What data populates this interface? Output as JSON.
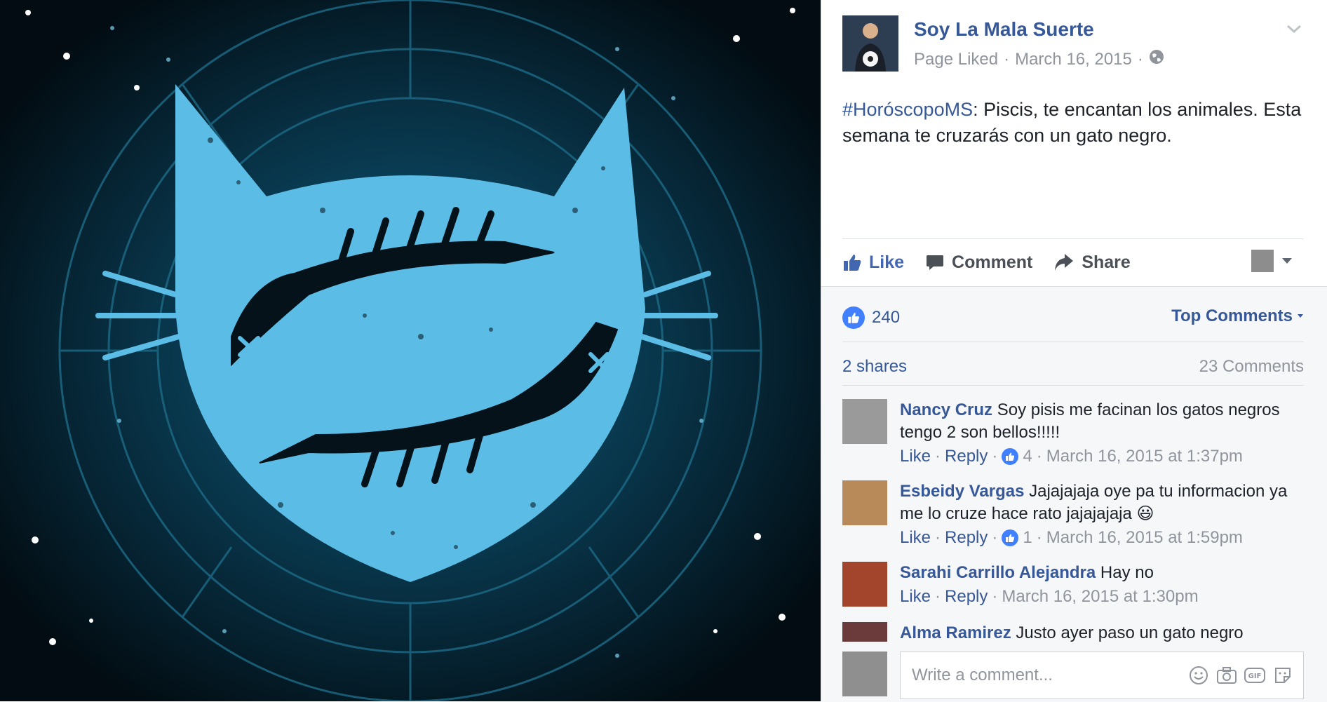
{
  "page": {
    "name": "Soy La Mala Suerte",
    "liked_status": "Page Liked",
    "date": "March 16, 2015",
    "separator": "·",
    "audience_icon": "globe-icon"
  },
  "post": {
    "hashtag": "#HoróscopoMS",
    "text": ": Piscis, te encantan los animales. Esta semana te cruzarás con un gato negro."
  },
  "actions": {
    "like": "Like",
    "comment": "Comment",
    "share": "Share"
  },
  "stats": {
    "likes": "240",
    "shares": "2 shares",
    "comments": "23 Comments",
    "sort_label": "Top Comments"
  },
  "comments": [
    {
      "author": "Nancy Cruz",
      "text": "Soy pisis me facinan los gatos negros tengo 2 son bellos!!!!!",
      "like": "Like",
      "reply": "Reply",
      "likes": "4",
      "time": "March 16, 2015 at 1:37pm",
      "avatar_color": "#9a9a9a"
    },
    {
      "author": "Esbeidy Vargas",
      "text": "Jajajajaja oye pa tu informacion ya me lo cruze hace rato jajajajaja 😃",
      "like": "Like",
      "reply": "Reply",
      "likes": "1",
      "time": "March 16, 2015 at 1:59pm",
      "avatar_color": "#b88a5a"
    },
    {
      "author": "Sarahi Carrillo Alejandra",
      "text": "Hay no",
      "like": "Like",
      "reply": "Reply",
      "time": "March 16, 2015 at 1:30pm",
      "avatar_color": "#a3442c"
    },
    {
      "author": "Alma Ramirez",
      "text": "Justo ayer paso un gato negro",
      "avatar_color": "#6b3b3b"
    }
  ],
  "composer": {
    "placeholder": "Write a comment..."
  },
  "colors": {
    "link": "#365899",
    "accent": "#4267b2",
    "cat": "#5bbde6",
    "sky": "#041a24"
  }
}
